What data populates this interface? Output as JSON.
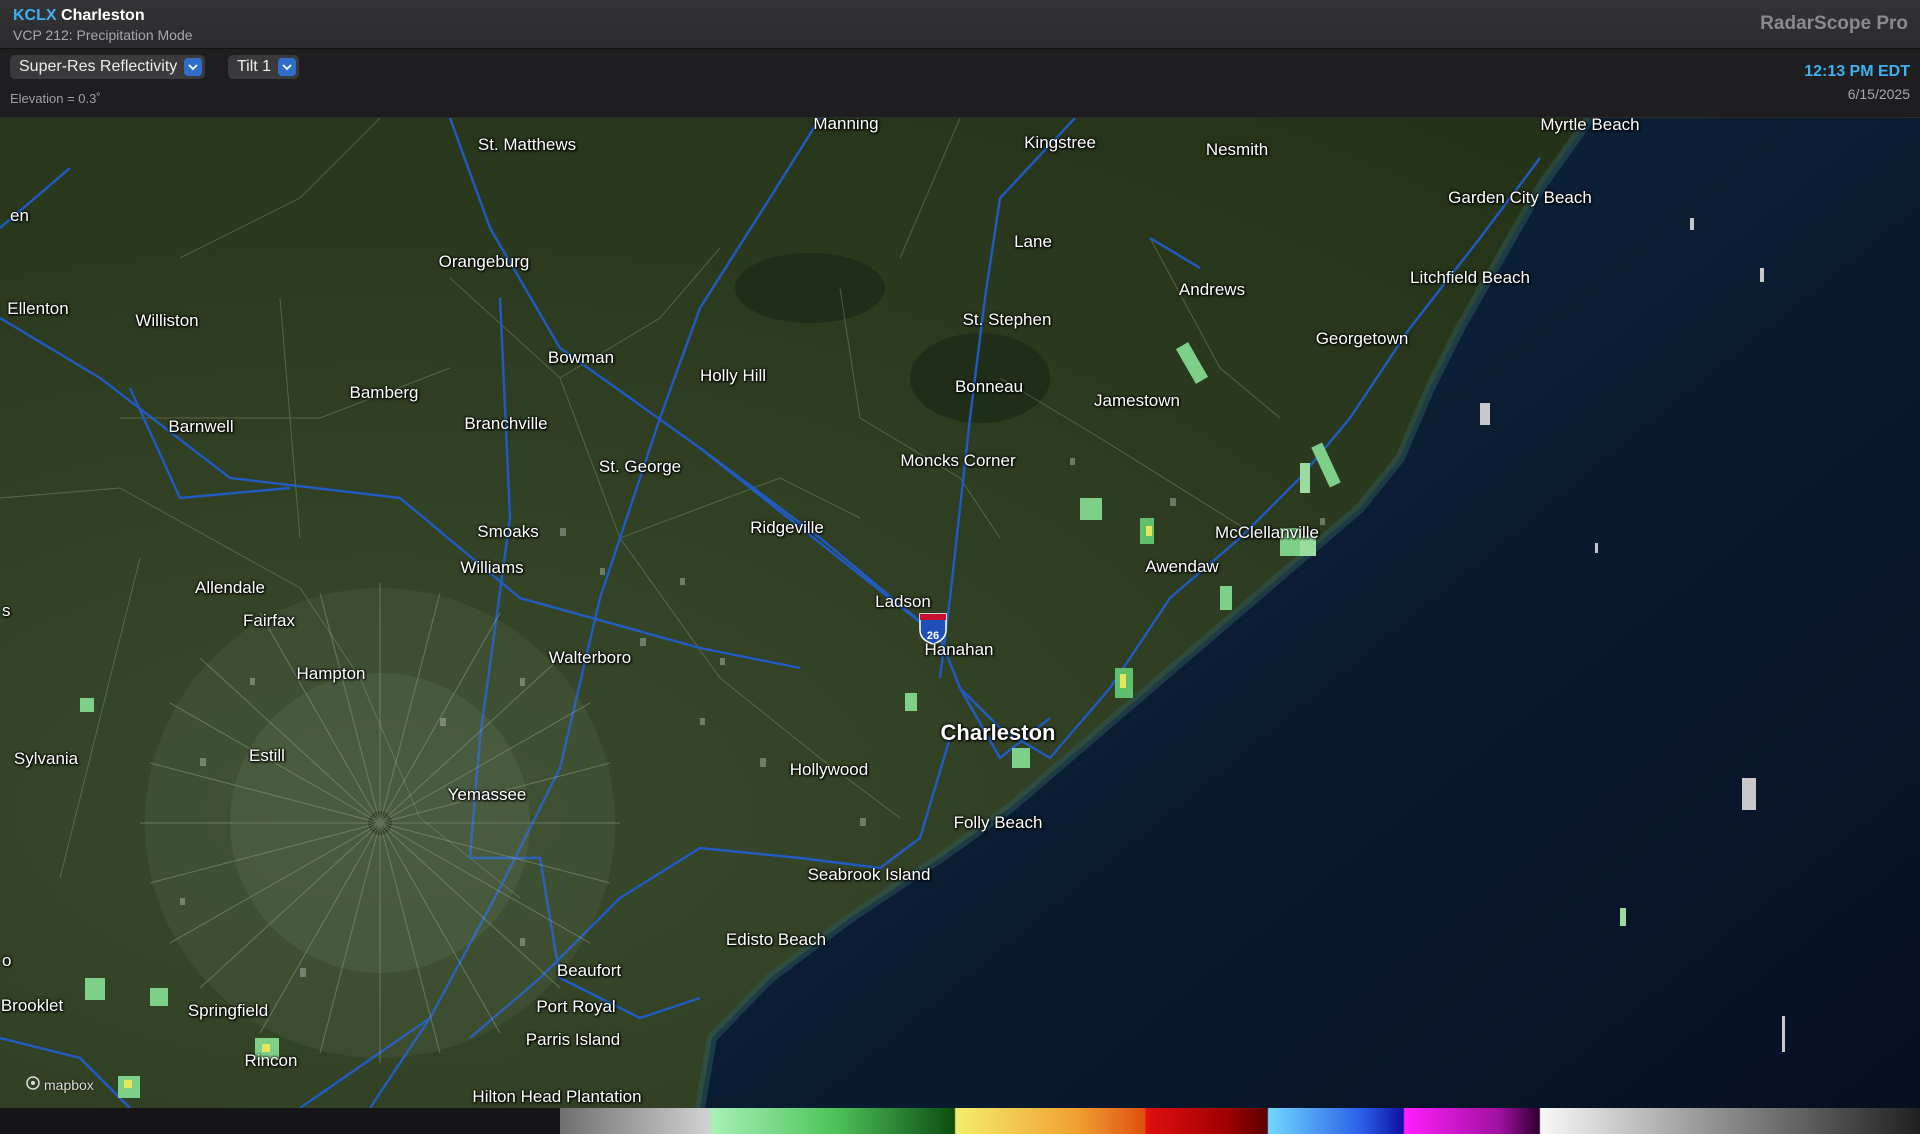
{
  "header": {
    "station_code": "KCLX",
    "station_name": "Charleston",
    "vcp": "VCP 212: Precipitation Mode",
    "brand": "RadarScope Pro"
  },
  "toolbar": {
    "product": "Super-Res Reflectivity",
    "tilt": "Tilt 1",
    "elevation": "Elevation = 0.3˚",
    "time": "12:13 PM EDT",
    "date": "6/15/2025"
  },
  "map": {
    "cities": [
      "Manning",
      "St. Matthews",
      "Kingstree",
      "Nesmith",
      "Myrtle Beach",
      "en",
      "Garden City Beach",
      "Orangeburg",
      "Lane",
      "Ellenton",
      "Williston",
      "Andrews",
      "Litchfield Beach",
      "St. Stephen",
      "Georgetown",
      "Bowman",
      "Holly Hill",
      "Bamberg",
      "Bonneau",
      "Jamestown",
      "Barnwell",
      "Branchville",
      "St. George",
      "Moncks Corner",
      "Smoaks",
      "Ridgeville",
      "McClellanville",
      "Williams",
      "Awendaw",
      "Allendale",
      "Ladson",
      "Fairfax",
      "Hanahan",
      "Walterboro",
      "Hampton",
      "Charleston",
      "Sylvania",
      "Estill",
      "Hollywood",
      "Yemassee",
      "Folly Beach",
      "Seabrook Island",
      "Edisto Beach",
      "Beaufort",
      "Brooklet",
      "Springfield",
      "Port Royal",
      "Parris Island",
      "Rincon",
      "Hilton Head Plantation",
      "o",
      "s"
    ],
    "interstate_shield": "26",
    "attribution": "mapbox"
  },
  "colors": {
    "accent": "#3fb0f0",
    "ocean": "#0a1a33",
    "land": "#2b3a1f",
    "highway": "#1f5fd6"
  }
}
